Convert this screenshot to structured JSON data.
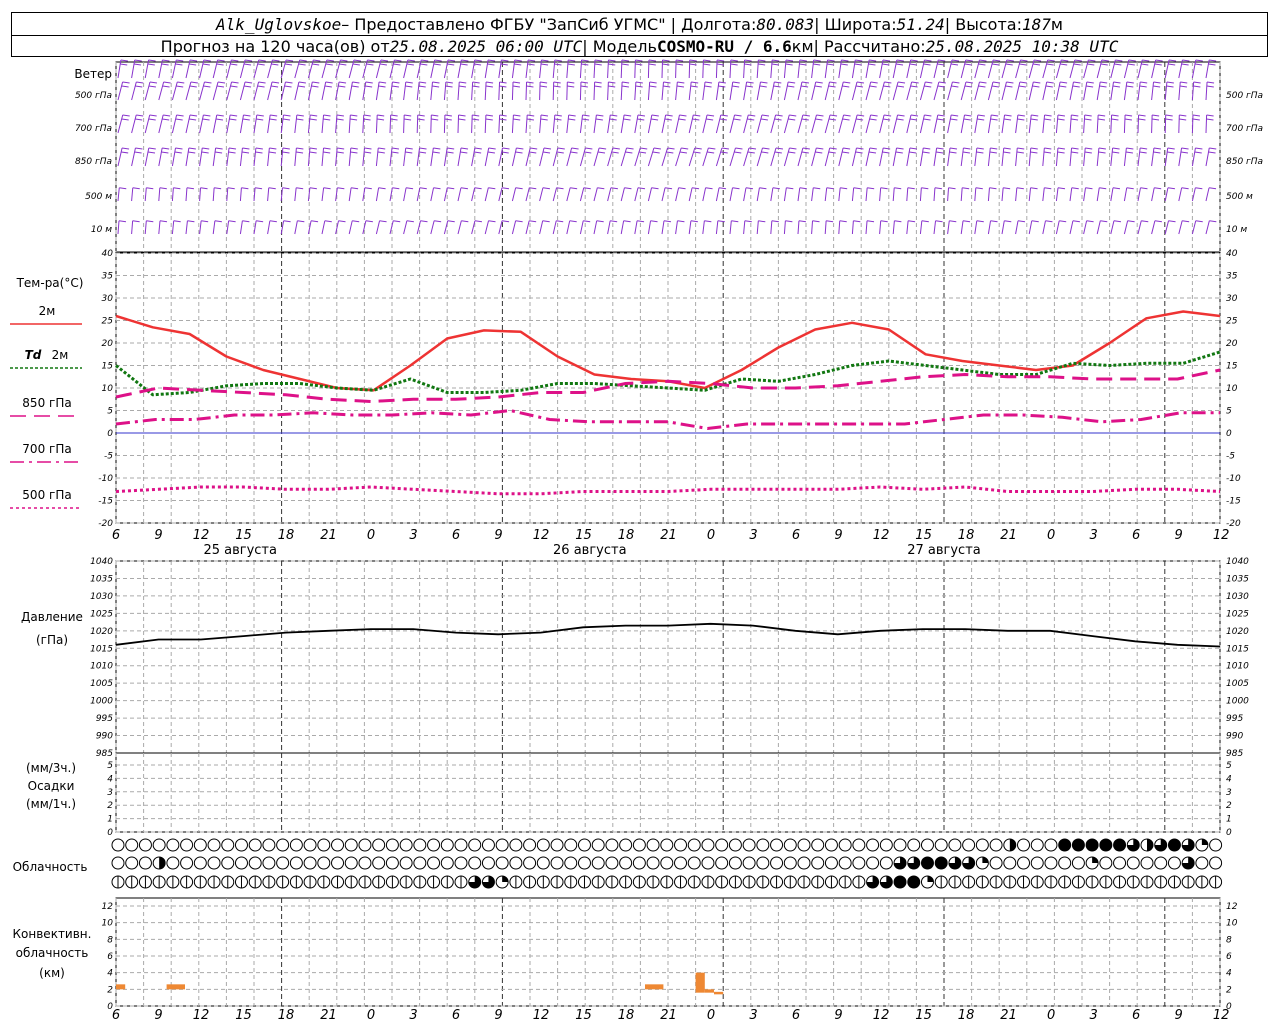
{
  "header": {
    "station": "Alk_Uglovskoe",
    "provider": " – Предоставлено ФГБУ \"ЗапСиб УГМС\" | Долгота: ",
    "lon": "80.083",
    "lat_label": " | Широта: ",
    "lat": "51.24",
    "alt_label": " | Высота: ",
    "alt": "187",
    "alt_unit": "м",
    "forecast_label": "Прогноз на 120 часа(ов) от ",
    "forecast_from": "25.08.2025 06:00 UTC",
    "model_label": " | Модель ",
    "model": "COSMO-RU / 6.6",
    "model_unit": "км",
    "calc_label": " | Рассчитано: ",
    "calc_time": "25.08.2025 10:38 UTC"
  },
  "labels": {
    "wind": "Ветер",
    "levels": [
      "500 гПа",
      "700 гПа",
      "850 гПа",
      "500 м",
      "10  м"
    ],
    "temp": "Тем-ра(°C)",
    "t2m": "2м",
    "td": "Td",
    "td_2m": "2м",
    "t850": "850 гПа",
    "t700": "700 гПа",
    "t500": "500 гПа",
    "pressure1": "Давление",
    "pressure2": "(гПа)",
    "precip1": "(мм/3ч.)",
    "precip2": "Осадки",
    "precip3": "(мм/1ч.)",
    "cloud": "Облачность",
    "conv1": "Конвективн.",
    "conv2": "облачность",
    "conv3": "(км)"
  },
  "chart_data": [
    {
      "type": "line",
      "name": "temperature",
      "x_hours": [
        0,
        3,
        6,
        9,
        12,
        15,
        18,
        21,
        24,
        27,
        30,
        33,
        36,
        39,
        42,
        45,
        48,
        51,
        54,
        57,
        60,
        63,
        66,
        69,
        72,
        75,
        78,
        81,
        84,
        87,
        90,
        93,
        96,
        99,
        102,
        105,
        108,
        111,
        114,
        117,
        120
      ],
      "x_tick_labels": [
        "6",
        "9",
        "12",
        "15",
        "18",
        "21",
        "0",
        "3",
        "6",
        "9",
        "12",
        "15",
        "18",
        "21",
        "0",
        "3",
        "6",
        "9",
        "12",
        "15",
        "18",
        "21",
        "0",
        "3",
        "6",
        "9",
        "12"
      ],
      "day_labels": [
        "25 августа",
        "26 августа",
        "27 августа"
      ],
      "ylim": [
        -20,
        40
      ],
      "y_ticks": [
        -20,
        -15,
        -10,
        -5,
        0,
        5,
        10,
        15,
        20,
        25,
        30,
        35,
        40
      ],
      "series": [
        {
          "name": "2м",
          "color": "#ee3333",
          "values": [
            26,
            23.5,
            22,
            17,
            14,
            12,
            10,
            9.5,
            15,
            21,
            22.8,
            22.5,
            17,
            13,
            12,
            11.5,
            10,
            14,
            19,
            23,
            24.5,
            23,
            17.5,
            16,
            15,
            14,
            15,
            20,
            25.5,
            27,
            26
          ]
        },
        {
          "name": "Td 2м",
          "color": "#117711",
          "values": [
            15,
            8.5,
            9,
            10.5,
            11,
            11,
            10,
            9.5,
            12,
            9,
            9,
            9.5,
            11,
            11,
            10.5,
            10,
            9.5,
            12,
            11.5,
            13,
            15,
            16,
            15,
            14,
            13,
            13,
            15.5,
            15,
            15.5,
            15.5,
            18
          ]
        },
        {
          "name": "850 гПа",
          "color": "#dd1188",
          "values": [
            8,
            10,
            9.5,
            9,
            8.5,
            7.5,
            7,
            7.5,
            7.5,
            8,
            9,
            9,
            11,
            11.5,
            11,
            10,
            10,
            10.5,
            11.5,
            12.5,
            13,
            12.5,
            12.5,
            12,
            12,
            12,
            14
          ]
        },
        {
          "name": "700 гПа",
          "color": "#dd1188",
          "values": [
            2,
            3,
            3,
            4,
            4,
            4.5,
            4,
            4,
            4.5,
            4,
            5,
            3,
            2.5,
            2.5,
            2.5,
            1,
            2,
            2,
            2,
            2,
            2,
            3,
            4,
            4,
            3.5,
            2.5,
            3,
            4.5,
            4.5
          ]
        },
        {
          "name": "500 гПа",
          "color": "#dd1188",
          "values": [
            -13,
            -12.5,
            -12,
            -12,
            -12.5,
            -12.5,
            -12,
            -12.5,
            -13,
            -13.5,
            -13.5,
            -13,
            -13,
            -13,
            -12.5,
            -12.5,
            -12.5,
            -12.5,
            -12,
            -12.5,
            -12,
            -13,
            -13,
            -13,
            -12.5,
            -12.5,
            -13
          ]
        }
      ]
    },
    {
      "type": "line",
      "name": "pressure",
      "ylim": [
        985,
        1040
      ],
      "y_ticks": [
        985,
        990,
        995,
        1000,
        1005,
        1010,
        1015,
        1020,
        1025,
        1030,
        1035,
        1040
      ],
      "series": [
        {
          "name": "",
          "color": "#000000",
          "values": [
            1016,
            1017.5,
            1017.5,
            1018.5,
            1019.5,
            1020,
            1020.5,
            1020.5,
            1019.5,
            1019,
            1019.5,
            1021,
            1021.5,
            1021.5,
            1022,
            1021.5,
            1020,
            1019,
            1020,
            1020.5,
            1020.5,
            1020,
            1020,
            1018.5,
            1017,
            1016,
            1015.5
          ]
        }
      ]
    },
    {
      "type": "bar",
      "name": "precipitation",
      "ylim": [
        0,
        5
      ],
      "y_ticks": [
        0,
        1,
        2,
        3,
        4,
        5
      ],
      "values": []
    },
    {
      "type": "bar",
      "name": "convective_cloud",
      "ylim": [
        0,
        12
      ],
      "y_ticks": [
        0,
        2,
        4,
        6,
        8,
        10,
        12
      ],
      "bars": [
        {
          "hour": 0.5,
          "width": 1,
          "bottom": 2,
          "top": 2.6
        },
        {
          "hour": 6.5,
          "width": 2,
          "bottom": 2,
          "top": 2.6
        },
        {
          "hour": 58.5,
          "width": 2,
          "bottom": 2,
          "top": 2.6
        },
        {
          "hour": 63.5,
          "width": 1,
          "bottom": 1.6,
          "top": 4
        },
        {
          "hour": 64.5,
          "width": 1,
          "bottom": 1.6,
          "top": 2
        },
        {
          "hour": 65.5,
          "width": 1,
          "bottom": 1.4,
          "top": 1.7
        }
      ],
      "color": "#ee8833"
    }
  ],
  "clouds": {
    "row1_filled": {
      "65": 2,
      "69": 4,
      "70": 4,
      "71": 4,
      "72": 4,
      "73": 4,
      "74": 3,
      "75": 2,
      "76": 3,
      "77": 4,
      "78": 3,
      "79": 1
    },
    "row2_filled": {
      "3": 2,
      "57": 3,
      "58": 3,
      "59": 4,
      "60": 4,
      "61": 3,
      "62": 3,
      "63": 1,
      "71": 1,
      "78": 3
    },
    "row3_filled": {
      "26": 3,
      "27": 3,
      "28": 1,
      "55": 3,
      "56": 3,
      "57": 4,
      "58": 4,
      "59": 1
    }
  },
  "colors": {
    "grid": "#aaaaaa",
    "wind": "#8833cc",
    "zero_line": "#3333cc"
  }
}
